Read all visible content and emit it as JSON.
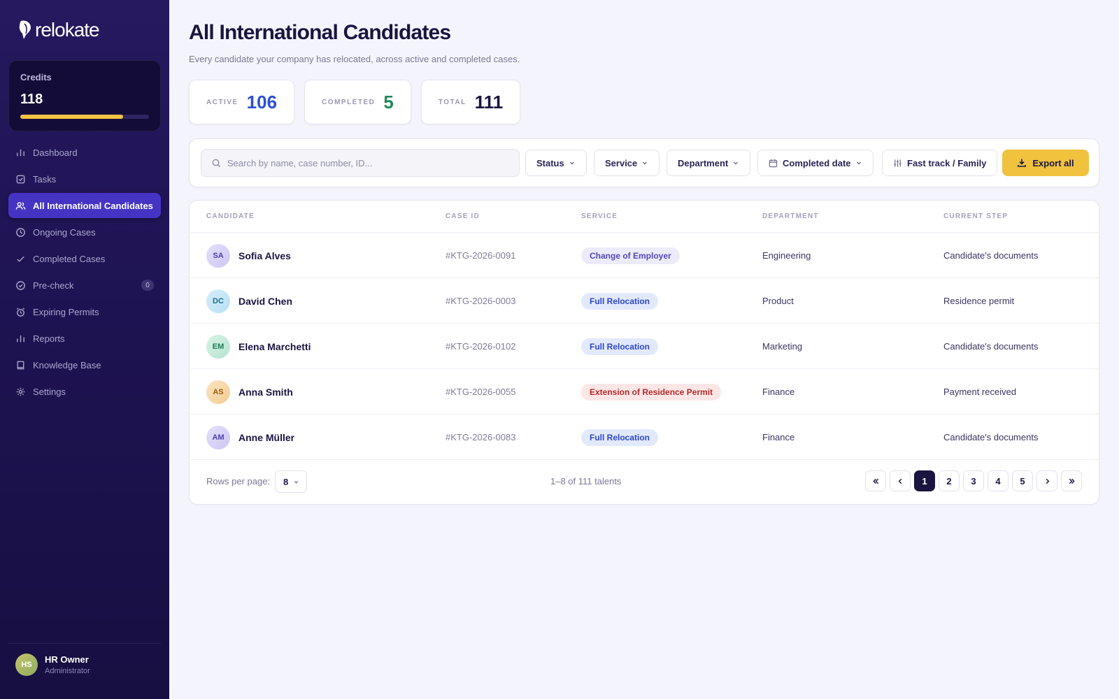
{
  "brand": {
    "name": "relokate"
  },
  "credits": {
    "label": "Credits",
    "value": "118",
    "fill_fraction": 0.8,
    "fill_color": "#f2c443"
  },
  "nav": [
    {
      "label": "Dashboard",
      "icon": "bar-chart-icon"
    },
    {
      "label": "Tasks",
      "icon": "checkbox-icon"
    },
    {
      "label": "All International Candidates",
      "icon": "users-icon",
      "active": true
    },
    {
      "label": "Ongoing Cases",
      "icon": "clock-icon"
    },
    {
      "label": "Completed Cases",
      "icon": "check-icon"
    },
    {
      "label": "Pre-check",
      "icon": "check-circle-icon",
      "badge": "0"
    },
    {
      "label": "Expiring Permits",
      "icon": "alarm-clock-icon"
    },
    {
      "label": "Reports",
      "icon": "bar-chart-icon"
    },
    {
      "label": "Knowledge Base",
      "icon": "book-icon"
    },
    {
      "label": "Settings",
      "icon": "gear-icon"
    }
  ],
  "user": {
    "initials": "HS",
    "name": "HR Owner",
    "role": "Administrator"
  },
  "page": {
    "title": "All International Candidates",
    "subtitle": "Every candidate your company has relocated, across active and completed cases."
  },
  "stats": [
    {
      "label": "ACTIVE",
      "value": "106",
      "color": "#2d4fd6"
    },
    {
      "label": "COMPLETED",
      "value": "5",
      "color": "#1f8a5b"
    },
    {
      "label": "TOTAL",
      "value": "111",
      "color": "#1a1440"
    }
  ],
  "toolbar": {
    "search_placeholder": "Search by name, case number, ID...",
    "filters": {
      "status": "Status",
      "service": "Service",
      "department": "Department",
      "completed_date": "Completed date",
      "fast_track": "Fast track / Family"
    },
    "export_label": "Export all",
    "export_color": "#f0c23e"
  },
  "table": {
    "columns": [
      "CANDIDATE",
      "CASE ID",
      "SERVICE",
      "DEPARTMENT",
      "CURRENT STEP"
    ],
    "rows": [
      {
        "initials": "SA",
        "name": "Sofia Alves",
        "case_id": "#KTG-2026-0091",
        "service": "Change of Employer",
        "service_variant": "purple",
        "department": "Engineering",
        "step": "Candidate's documents",
        "avatar_variant": "lavender"
      },
      {
        "initials": "DC",
        "name": "David Chen",
        "case_id": "#KTG-2026-0003",
        "service": "Full Relocation",
        "service_variant": "blue",
        "department": "Product",
        "step": "Residence permit",
        "avatar_variant": "sky"
      },
      {
        "initials": "EM",
        "name": "Elena Marchetti",
        "case_id": "#KTG-2026-0102",
        "service": "Full Relocation",
        "service_variant": "blue",
        "department": "Marketing",
        "step": "Candidate's documents",
        "avatar_variant": "mint"
      },
      {
        "initials": "AS",
        "name": "Anna Smith",
        "case_id": "#KTG-2026-0055",
        "service": "Extension of Residence Permit",
        "service_variant": "red",
        "department": "Finance",
        "step": "Payment received",
        "avatar_variant": "peach"
      },
      {
        "initials": "AM",
        "name": "Anne Müller",
        "case_id": "#KTG-2026-0083",
        "service": "Full Relocation",
        "service_variant": "blue",
        "department": "Finance",
        "step": "Candidate's documents",
        "avatar_variant": "lavender"
      }
    ]
  },
  "pagination": {
    "rows_per_page_label": "Rows per page:",
    "rows_per_page": "8",
    "range_text": "1–8 of 111 talents",
    "pages": [
      "1",
      "2",
      "3",
      "4",
      "5"
    ],
    "current_page": "1"
  }
}
